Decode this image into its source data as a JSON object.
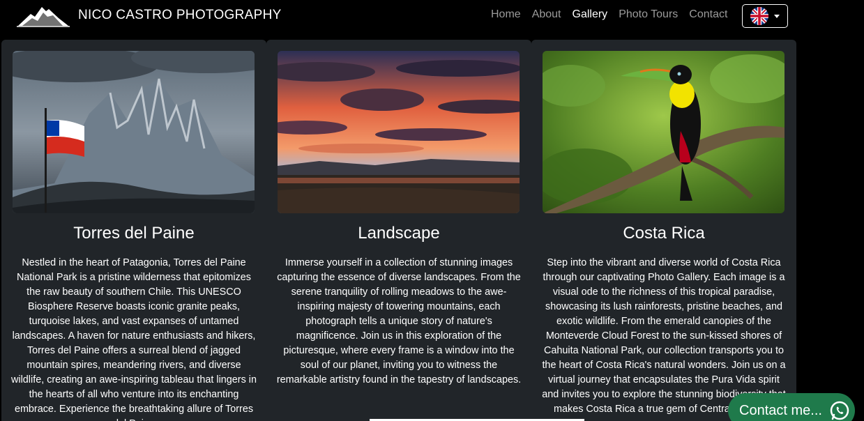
{
  "brand": {
    "name": "NICO CASTRO PHOTOGRAPHY",
    "logo_icon": "mountain-logo-icon"
  },
  "nav": {
    "items": [
      {
        "label": "Home",
        "active": false
      },
      {
        "label": "About",
        "active": false
      },
      {
        "label": "Gallery",
        "active": true
      },
      {
        "label": "Photo Tours",
        "active": false
      },
      {
        "label": "Contact",
        "active": false
      }
    ],
    "language_icon": "uk-flag-icon"
  },
  "cards": [
    {
      "title": "Torres del Paine",
      "image_icon": "torres-del-paine-photo",
      "text": "Nestled in the heart of Patagonia, Torres del Paine National Park is a pristine wilderness that epitomizes the raw beauty of southern Chile. This UNESCO Biosphere Reserve boasts iconic granite peaks, turquoise lakes, and vast expanses of untamed landscapes. A haven for nature enthusiasts and hikers, Torres del Paine offers a surreal blend of jagged mountain spires, meandering rivers, and diverse wildlife, creating an awe-inspiring tableau that lingers in the hearts of all who venture into its enchanting embrace. Experience the breathtaking allure of Torres del Paine"
    },
    {
      "title": "Landscape",
      "image_icon": "sunset-landscape-photo",
      "text": "Immerse yourself in a collection of stunning images capturing the essence of diverse landscapes. From the serene tranquility of rolling meadows to the awe-inspiring majesty of towering mountains, each photograph tells a unique story of nature's magnificence. Join us in this exploration of the picturesque, where every frame is a window into the soul of our planet, inviting you to witness the remarkable artistry found in the tapestry of landscapes."
    },
    {
      "title": "Costa Rica",
      "image_icon": "toucan-photo",
      "text": "Step into the vibrant and diverse world of Costa Rica through our captivating Photo Gallery. Each image is a visual ode to the richness of this tropical paradise, showcasing its lush rainforests, pristine beaches, and exotic wildlife. From the emerald canopies of the Monteverde Cloud Forest to the sun-kissed shores of Cahuita National Park, our collection transports you to the heart of Costa Rica's natural wonders. Join us on a virtual journey that encapsulates the Pura Vida spirit and invites you to explore the stunning biodiversity that makes Costa Rica a true gem of Central America."
    }
  ],
  "contact_button": {
    "label": "Contact me...",
    "icon": "whatsapp-icon"
  },
  "colors": {
    "background": "#000000",
    "card": "#212529",
    "contact_green": "#1f7a4b",
    "nav_muted": "#9b9b9b"
  }
}
